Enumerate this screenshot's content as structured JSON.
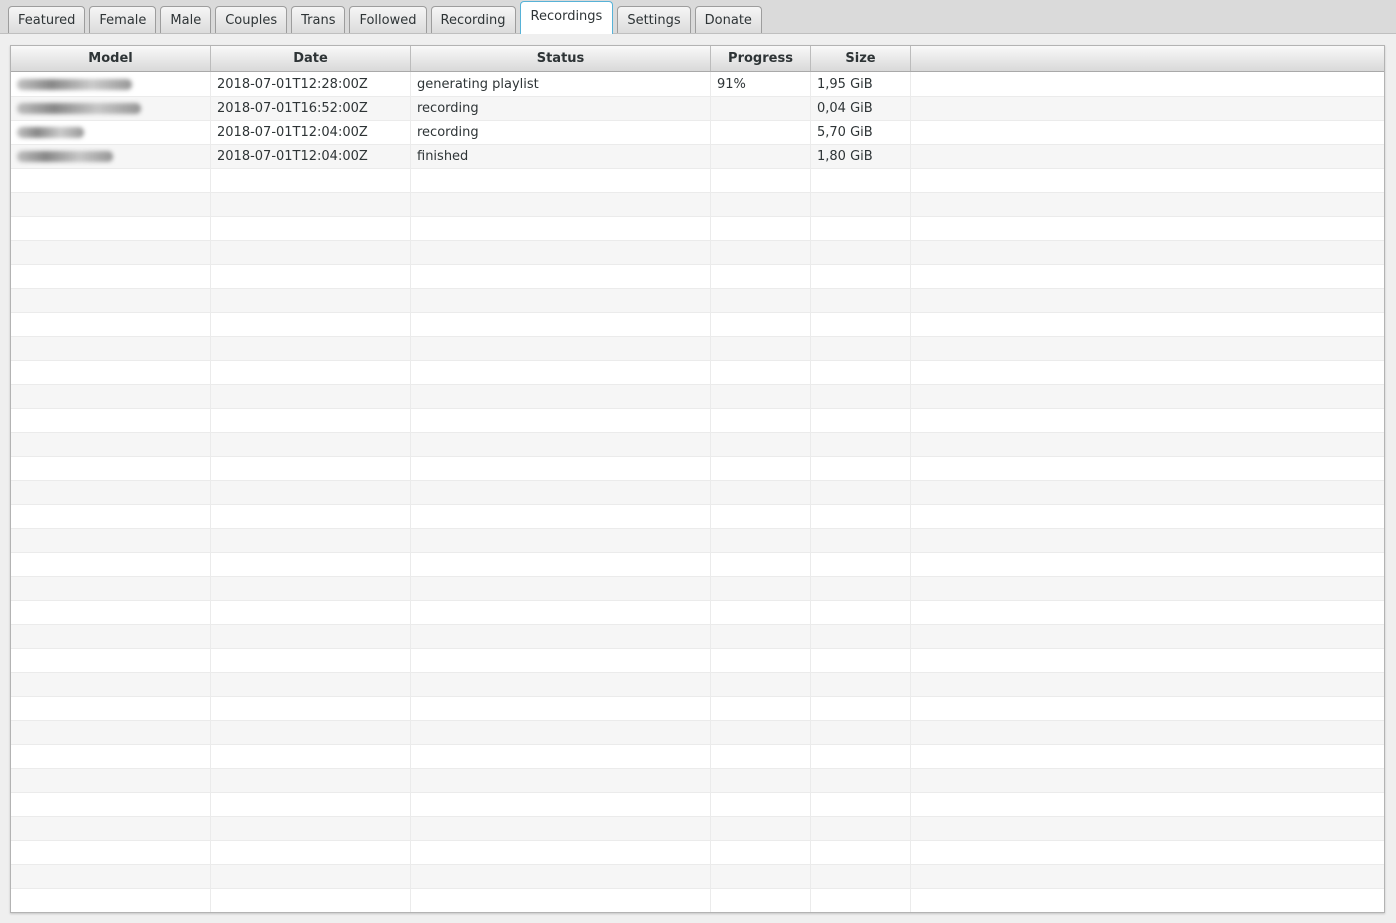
{
  "colors": {
    "active_tab_border": "#57b2d7"
  },
  "tabs": [
    {
      "label": "Featured",
      "active": false
    },
    {
      "label": "Female",
      "active": false
    },
    {
      "label": "Male",
      "active": false
    },
    {
      "label": "Couples",
      "active": false
    },
    {
      "label": "Trans",
      "active": false
    },
    {
      "label": "Followed",
      "active": false
    },
    {
      "label": "Recording",
      "active": false
    },
    {
      "label": "Recordings",
      "active": true
    },
    {
      "label": "Settings",
      "active": false
    },
    {
      "label": "Donate",
      "active": false
    }
  ],
  "table": {
    "columns": [
      "Model",
      "Date",
      "Status",
      "Progress",
      "Size",
      ""
    ],
    "rows": [
      {
        "model_redacted": true,
        "model_blur_width": 115,
        "date": "2018-07-01T12:28:00Z",
        "status": "generating playlist",
        "progress": "91%",
        "size": "1,95 GiB"
      },
      {
        "model_redacted": true,
        "model_blur_width": 124,
        "date": "2018-07-01T16:52:00Z",
        "status": "recording",
        "progress": "",
        "size": "0,04 GiB"
      },
      {
        "model_redacted": true,
        "model_blur_width": 67,
        "date": "2018-07-01T12:04:00Z",
        "status": "recording",
        "progress": "",
        "size": "5,70 GiB"
      },
      {
        "model_redacted": true,
        "model_blur_width": 96,
        "date": "2018-07-01T12:04:00Z",
        "status": "finished",
        "progress": "",
        "size": "1,80 GiB"
      }
    ],
    "empty_rows": 31
  }
}
